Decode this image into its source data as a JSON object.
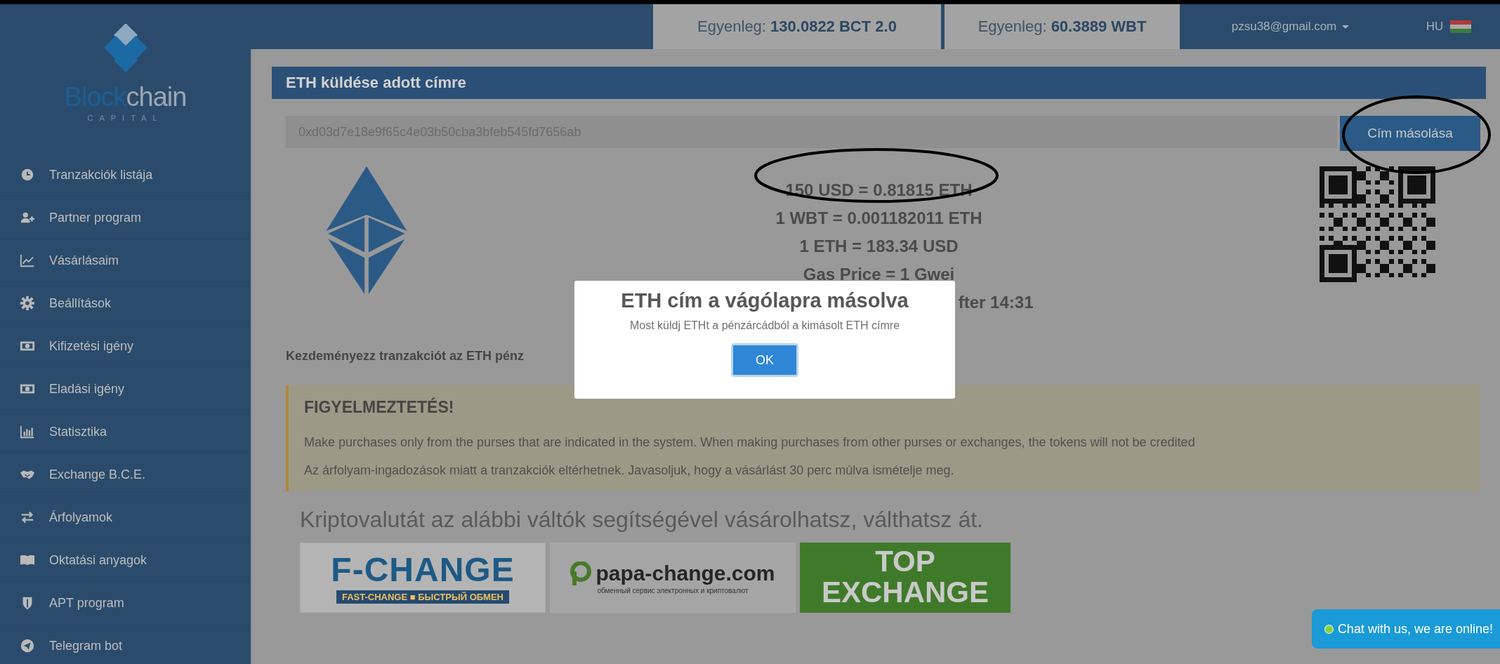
{
  "header": {
    "balances": [
      {
        "label": "Egyenleg:",
        "value": "130.0822 BCT 2.0"
      },
      {
        "label": "Egyenleg:",
        "value": "60.3889 WBT"
      }
    ],
    "user_email": "pzsu38@gmail.com",
    "language": "HU"
  },
  "sidebar": {
    "logo": {
      "word_part1": "Block",
      "word_part2": "chain",
      "tagline": "CAPITAL"
    },
    "items": [
      {
        "label": "Tranzakciók listája"
      },
      {
        "label": "Partner program"
      },
      {
        "label": "Vásárlásaim"
      },
      {
        "label": "Beállítások"
      },
      {
        "label": "Kifizetési igény"
      },
      {
        "label": "Eladási igény"
      },
      {
        "label": "Statisztika"
      },
      {
        "label": "Exchange B.C.E."
      },
      {
        "label": "Árfolyamok"
      },
      {
        "label": "Oktatási anyagok"
      },
      {
        "label": "APT program"
      },
      {
        "label": "Telegram bot"
      }
    ]
  },
  "panel": {
    "title": "ETH küldése adott címre",
    "address": "0xd03d7e18e9f65c4e03b50cba3bfeb545fd7656ab",
    "copy_button": "Cím másolása",
    "rates": [
      {
        "text": "150 USD = 0.81815 ETH",
        "kind": "full"
      },
      {
        "text": "1 WBT = 0.001182011 ETH",
        "kind": "full"
      },
      {
        "text": "1 ETH = 183.34 USD",
        "kind": "full"
      },
      {
        "text": "Gas Price = 1 Gwei",
        "kind": "full"
      },
      {
        "text": "fter 14:31",
        "kind": "partial"
      }
    ],
    "instruction": "Kezdeményezz tranzakciót az ETH pénz",
    "warning": {
      "title": "FIGYELMEZTETÉS!",
      "lines": [
        "Make purchases only from the purses that are indicated in the system. When making purchases from other purses or exchanges, the tokens will not be credited",
        "Az árfolyam-ingadozások miatt a tranzakciók eltérhetnek. Javasoljuk, hogy a vásárlást 30 perc múlva ismételje meg."
      ]
    },
    "exchangers_heading": "Kriptovalutát az alábbi váltók segítségével vásárolhatsz, válthatsz át.",
    "exchangers": [
      {
        "kind": "fchange",
        "title": "F-CHANGE",
        "subtitle": "FAST-CHANGE ■ БЫСТРЫЙ ОБМЕН"
      },
      {
        "kind": "papa",
        "title": "papa-change.com",
        "subtitle": "обменный сервис электронных и криптовалют"
      },
      {
        "kind": "topex",
        "title": "TOP",
        "subtitle": "EXCHANGE"
      }
    ]
  },
  "modal": {
    "title": "ETH cím a vágólapra másolva",
    "message": "Most küldj ETHt a pénzárcádból a kimásolt ETH címre",
    "ok_button": "OK"
  },
  "chat_button": "Chat with us, we are online!"
}
